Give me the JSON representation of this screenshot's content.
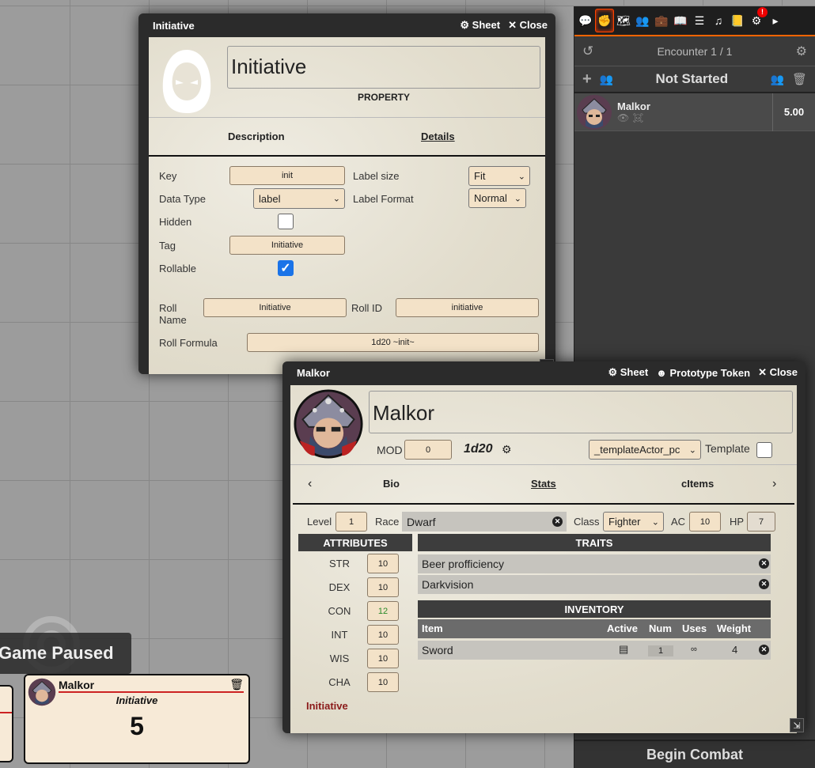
{
  "sidebar": {
    "tab_icons": [
      "chat-icon",
      "combat-fist-icon",
      "scenes-map-icon",
      "actors-icon",
      "items-icon",
      "journal-icon",
      "tables-icon",
      "playlists-icon",
      "compendium-icon",
      "settings-icon",
      "collapse-arrow-icon"
    ],
    "notification": "!",
    "encounter_title": "Encounter 1 / 1",
    "status": "Not Started",
    "combatant": {
      "name": "Malkor",
      "initiative": "5.00"
    },
    "begin_combat": "Begin Combat"
  },
  "initiative_window": {
    "header_title": "Initiative",
    "sheet_label": "Sheet",
    "close_label": "Close",
    "name_value": "Initiative",
    "type_label": "PROPERTY",
    "tabs": [
      "Description",
      "Details"
    ],
    "active_tab": "Details",
    "key_label": "Key",
    "key_value": "init",
    "label_size_label": "Label size",
    "label_size_value": "Fit",
    "data_type_label": "Data Type",
    "data_type_value": "label",
    "label_format_label": "Label Format",
    "label_format_value": "Normal",
    "hidden_label": "Hidden",
    "hidden_checked": false,
    "tag_label": "Tag",
    "tag_value": "Initiative",
    "rollable_label": "Rollable",
    "rollable_checked": true,
    "roll_name_label": "Roll Name",
    "roll_name_value": "Initiative",
    "roll_id_label": "Roll ID",
    "roll_id_value": "initiative",
    "roll_formula_label": "Roll Formula",
    "roll_formula_value": "1d20 ~init~"
  },
  "malkor_window": {
    "header_title": "Malkor",
    "sheet_label": "Sheet",
    "prototype_label": "Prototype Token",
    "close_label": "Close",
    "name_value": "Malkor",
    "mod_label": "MOD",
    "mod_value": "0",
    "dice_label": "1d20",
    "template_select": "_templateActor_pc",
    "template_label": "Template",
    "tabs": [
      "Bio",
      "Stats",
      "cItems"
    ],
    "active_tab": "Stats",
    "level_label": "Level",
    "level_value": "1",
    "race_label": "Race",
    "race_value": "Dwarf",
    "class_label": "Class",
    "class_value": "Fighter",
    "ac_label": "AC",
    "ac_value": "10",
    "hp_label": "HP",
    "hp_value": "7",
    "attributes_header": "ATTRIBUTES",
    "attributes": [
      {
        "name": "STR",
        "value": "10"
      },
      {
        "name": "DEX",
        "value": "10"
      },
      {
        "name": "CON",
        "value": "12"
      },
      {
        "name": "INT",
        "value": "10"
      },
      {
        "name": "WIS",
        "value": "10"
      },
      {
        "name": "CHA",
        "value": "10"
      }
    ],
    "initiative_link": "Initiative",
    "traits_header": "TRAITS",
    "traits": [
      "Beer profficiency",
      "Darkvision"
    ],
    "inventory_header": "INVENTORY",
    "inventory_columns": [
      "Item",
      "Active",
      "Num",
      "Uses",
      "Weight"
    ],
    "inventory_rows": [
      {
        "item": "Sword",
        "num": "1",
        "uses": "∞",
        "weight": "4"
      }
    ]
  },
  "game_paused": "Game Paused",
  "token_card": {
    "name": "Malkor",
    "label": "Initiative",
    "value": "5"
  },
  "colors": {
    "accent": "#ff6400",
    "parchment": "#e8e3d6",
    "field": "#f3e2c8",
    "checkbox_blue": "#1a73e8",
    "initiative_link": "#8b1a1a"
  }
}
